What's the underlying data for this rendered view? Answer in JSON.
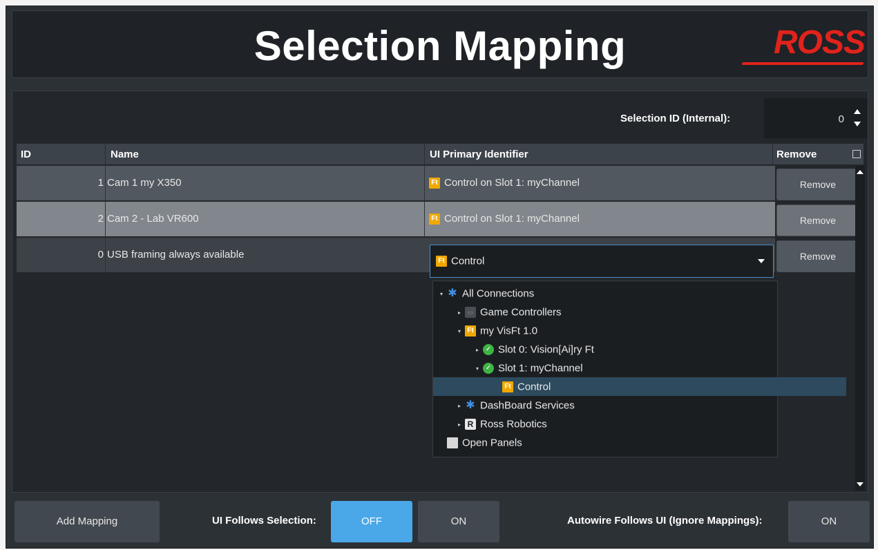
{
  "header": {
    "title": "Selection Mapping",
    "logo_text": "ROSS"
  },
  "selection_id": {
    "label": "Selection ID (Internal):",
    "value": "0"
  },
  "table": {
    "columns": {
      "id": "ID",
      "name": "Name",
      "uid": "UI Primary Identifier",
      "remove": "Remove"
    },
    "rows": [
      {
        "id": "1",
        "name": "Cam 1 my X350",
        "uid": "Control on Slot 1: myChannel",
        "remove": "Remove"
      },
      {
        "id": "2",
        "name": "Cam 2 - Lab VR600",
        "uid": "Control on Slot 1: myChannel",
        "remove": "Remove"
      },
      {
        "id": "0",
        "name": "USB framing always available",
        "uid": "Control",
        "remove": "Remove"
      }
    ],
    "ft_badge": "Ft"
  },
  "tree": {
    "items": [
      {
        "label": "All Connections",
        "icon": "gear-icon"
      },
      {
        "label": "Game Controllers",
        "icon": "gamepad-icon"
      },
      {
        "label": "my VisFt 1.0",
        "icon": "ft-icon"
      },
      {
        "label": "Slot 0: Vision[Ai]ry Ft",
        "icon": "check-icon"
      },
      {
        "label": "Slot 1: myChannel",
        "icon": "check-icon"
      },
      {
        "label": "Control",
        "icon": "ft-icon",
        "selected": true
      },
      {
        "label": "DashBoard Services",
        "icon": "gear-icon"
      },
      {
        "label": "Ross Robotics",
        "icon": "robotics-icon"
      },
      {
        "label": "Open Panels",
        "icon": "document-icon"
      }
    ]
  },
  "footer": {
    "add_mapping": "Add Mapping",
    "ui_follows_label": "UI Follows Selection:",
    "off": "OFF",
    "on": "ON",
    "autowire_label": "Autowire Follows UI (Ignore Mappings):",
    "autowire_on": "ON"
  },
  "colors": {
    "accent": "#4aa8e8",
    "logo": "#e0231c",
    "ft_badge": "#f0a800",
    "tree_selected": "#2d4a5e"
  }
}
